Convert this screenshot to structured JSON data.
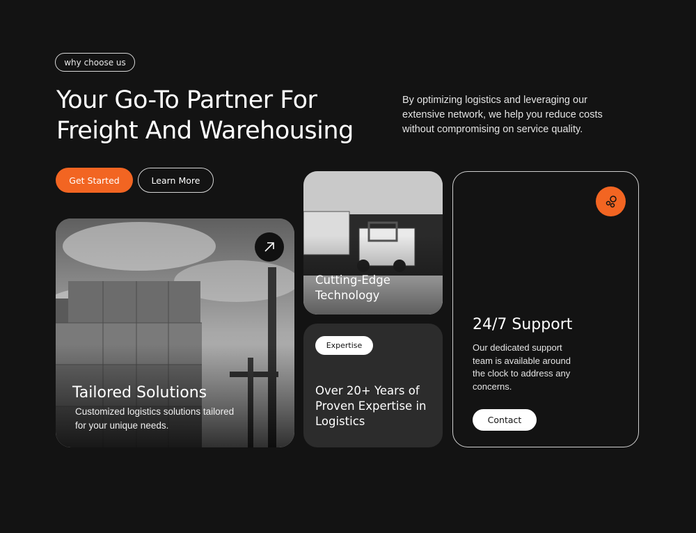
{
  "section": {
    "tag": "why choose us",
    "headline": "Your Go-To Partner For Freight And Warehousing",
    "intro": "By optimizing logistics and leveraging our extensive network, we help you reduce costs without compromising on service quality."
  },
  "buttons": {
    "primary": "Get Started",
    "secondary": "Learn More"
  },
  "cards": {
    "tailored": {
      "title": "Tailored Solutions",
      "description": "Customized logistics solutions tailored for your unique needs."
    },
    "tech": {
      "title": "Cutting-Edge Technology"
    },
    "expertise": {
      "badge": "Expertise",
      "text": "Over 20+ Years of Proven Expertise in Logistics"
    },
    "support": {
      "title": "24/7 Support",
      "description": "Our dedicated support team is available around the clock to address any concerns.",
      "button": "Contact"
    }
  },
  "colors": {
    "accent": "#f26522",
    "background": "#131313"
  },
  "icons": [
    "arrow-up-right-icon",
    "bubbles-icon"
  ]
}
